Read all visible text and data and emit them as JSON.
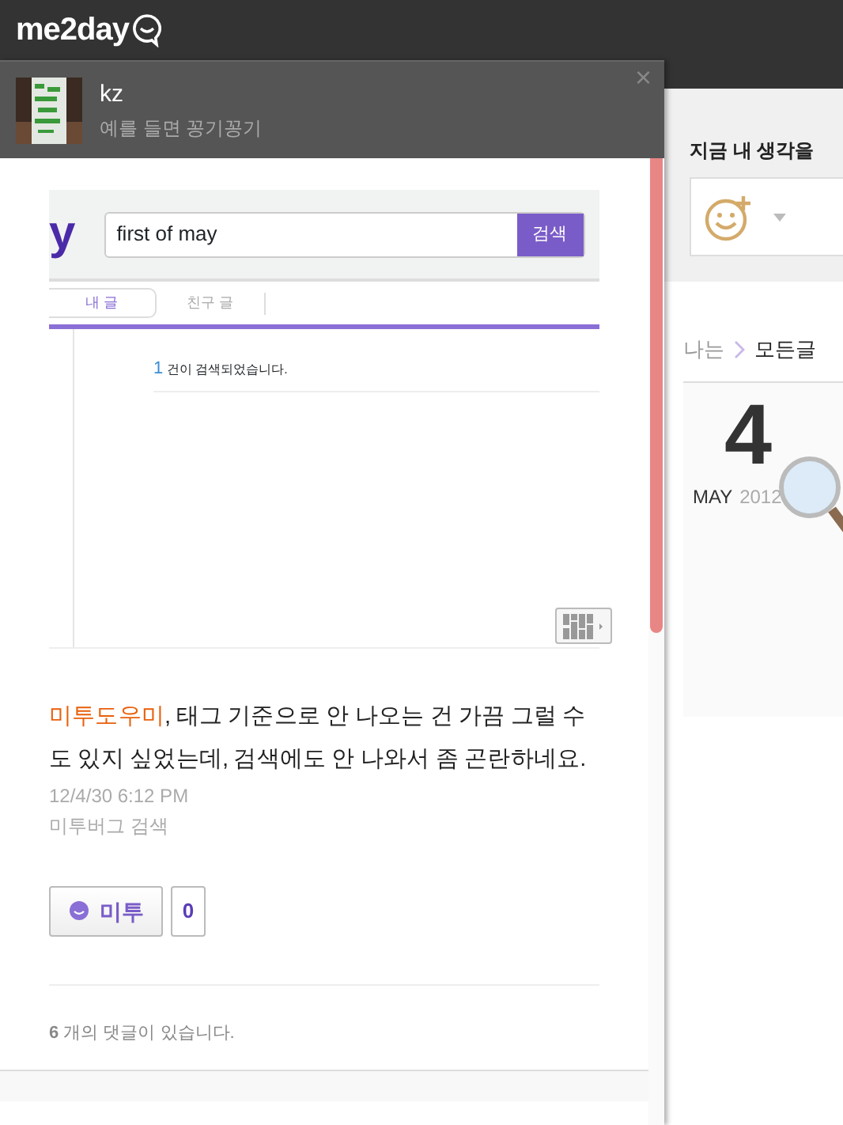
{
  "app": {
    "logo": "me2day"
  },
  "profile": {
    "name": "kz",
    "status": "예를 들면 꽁기꽁기",
    "close": "×"
  },
  "embedded_screenshot": {
    "logo_fragment": "y",
    "search": {
      "value": "first of may",
      "button": "검색"
    },
    "tabs": [
      {
        "label": "내 글",
        "selected": true
      },
      {
        "label": "친구 글",
        "selected": false
      }
    ],
    "result_count": "1",
    "result_text": "건이 검색되었습니다."
  },
  "post": {
    "mention": "미투도우미",
    "text": ", 태그 기준으로 안 나오는 건 가끔 그럴 수도 있지 싶었는데, 검색에도 안 나와서 좀 곤란하네요.",
    "time": "12/4/30 6:12 PM",
    "tag": "미투버그 검색",
    "me2_button": "미투",
    "me2_count": "0",
    "comments": "**6** 개의 댓글이 있습니다."
  },
  "side": {
    "prompt": "지금 내 생각을",
    "breadcrumb": [
      {
        "label": "나는",
        "selected": false
      },
      {
        "label": "모든글",
        "selected": true
      }
    ],
    "date": {
      "day": "4",
      "month": "MAY",
      "year": "2012"
    }
  }
}
